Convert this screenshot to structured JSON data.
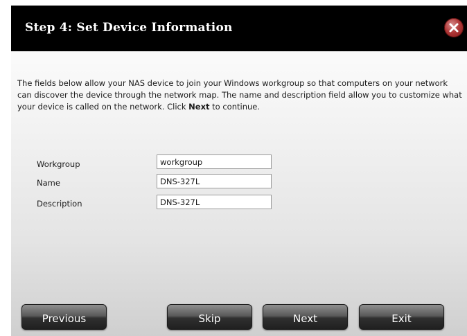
{
  "dialog": {
    "title": "Step 4: Set Device Information",
    "description_part1": "The fields below allow your NAS device to join your Windows workgroup so that computers on your network can discover the device through the network map. The name and description field allow you to customize what your device is called on the network. Click ",
    "description_bold": "Next",
    "description_part2": " to continue."
  },
  "form": {
    "fields": [
      {
        "label": "Workgroup",
        "value": "workgroup"
      },
      {
        "label": "Name",
        "value": "DNS-327L"
      },
      {
        "label": "Description",
        "value": "DNS-327L"
      }
    ]
  },
  "buttons": {
    "previous": "Previous",
    "skip": "Skip",
    "next": "Next",
    "exit": "Exit"
  },
  "icons": {
    "close": "close-icon"
  },
  "colors": {
    "titlebar": "#000000",
    "close_button": "#b03838",
    "button": "#3a3a3a"
  }
}
